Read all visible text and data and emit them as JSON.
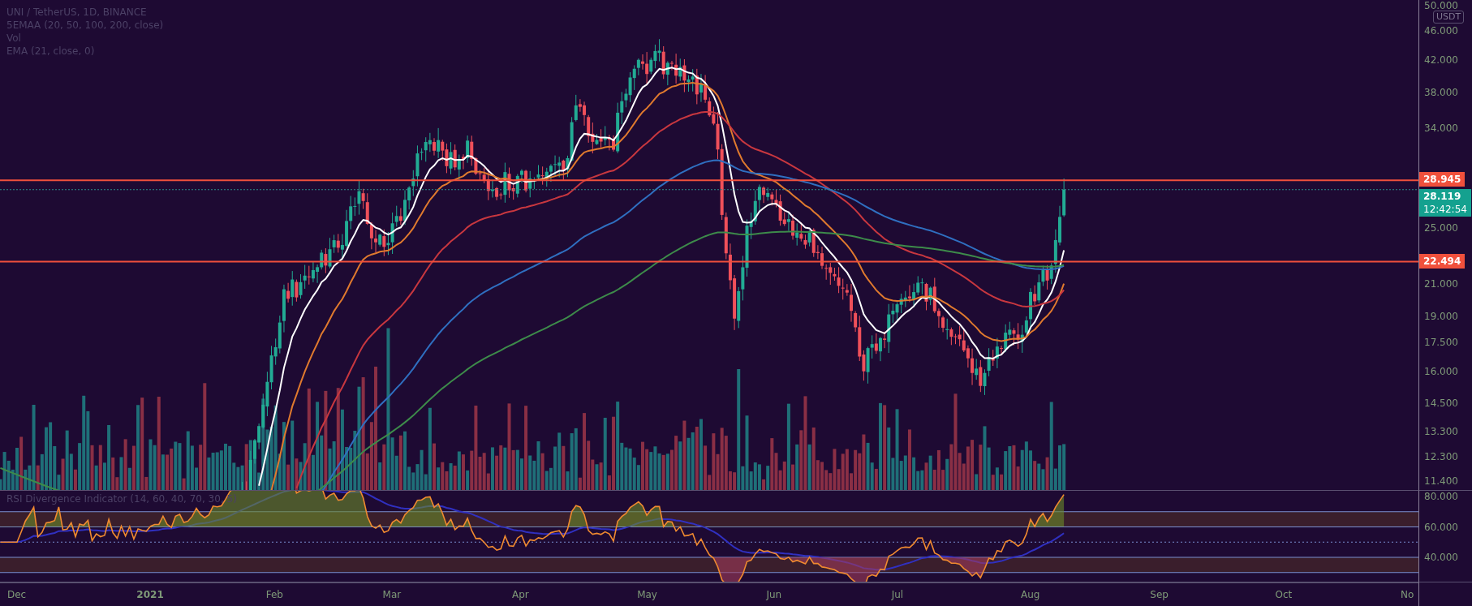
{
  "legend": [
    "UNI / TetherUS, 1D, BINANCE",
    "5EMAA (20, 50, 100, 200, close)",
    "Vol",
    "EMA (21, close, 0)"
  ],
  "rsi_legend": "RSI Divergence Indicator (14, 60, 40, 70, 30, 5)",
  "price_axis": {
    "currency": "USDT",
    "ticks": [
      "50.000",
      "46.000",
      "42.000",
      "38.000",
      "34.000",
      "25.000",
      "21.000",
      "19.000",
      "17.500",
      "16.000",
      "14.500",
      "13.300",
      "12.300",
      "11.400"
    ]
  },
  "price_tags": [
    {
      "kind": "level",
      "value": "28.945"
    },
    {
      "kind": "last",
      "value": "28.119",
      "countdown": "12:42:54"
    },
    {
      "kind": "level",
      "value": "22.494"
    }
  ],
  "rsi_axis": {
    "ticks": [
      "80.000",
      "60.000",
      "40.000"
    ]
  },
  "time_axis": {
    "labels": [
      {
        "text": "Dec",
        "kind": "month"
      },
      {
        "text": "2021",
        "kind": "year"
      },
      {
        "text": "Feb",
        "kind": "month"
      },
      {
        "text": "Mar",
        "kind": "month"
      },
      {
        "text": "Apr",
        "kind": "month"
      },
      {
        "text": "May",
        "kind": "month"
      },
      {
        "text": "Jun",
        "kind": "month"
      },
      {
        "text": "Jul",
        "kind": "month"
      },
      {
        "text": "Aug",
        "kind": "month"
      },
      {
        "text": "Sep",
        "kind": "month"
      },
      {
        "text": "Oct",
        "kind": "month"
      },
      {
        "text": "No",
        "kind": "month"
      }
    ]
  }
}
